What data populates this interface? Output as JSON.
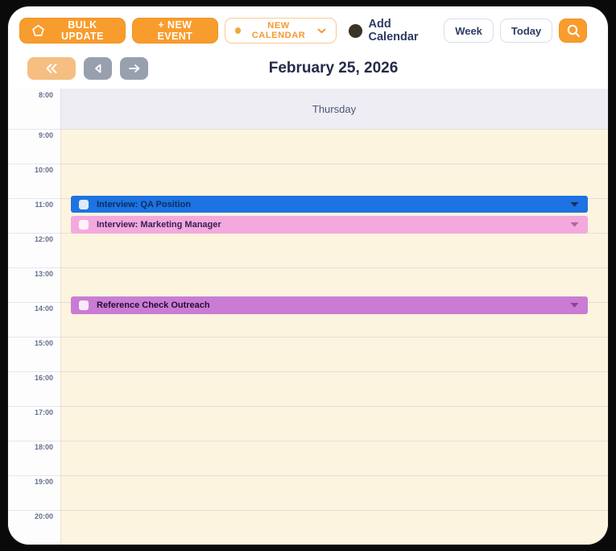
{
  "header": {
    "date_title": "February 25, 2026"
  },
  "toolbar": {
    "bulk_update_label": "BULK UPDATE",
    "new_event_label": "+ NEW EVENT",
    "calendar_select": {
      "label": "NEW CALENDAR"
    },
    "add_calendar_label": "Add Calendar",
    "week_label": "Week",
    "today_label": "Today"
  },
  "calendar": {
    "day_header": "Thursday",
    "time_labels": [
      "8:00",
      "9:00",
      "10:00",
      "11:00",
      "12:00",
      "13:00",
      "14:00",
      "15:00",
      "16:00",
      "17:00",
      "18:00",
      "19:00",
      "20:00"
    ],
    "events": [
      {
        "title": "Interview: QA Position",
        "color": "#1D73E2",
        "text_color": "#0C2D5E",
        "chevron_color": "#16305C"
      },
      {
        "title": "Interview: Marketing Manager",
        "color": "#F3A9DD",
        "text_color": "#372052",
        "chevron_color": "#B761A8"
      },
      {
        "title": "Reference Check Outreach",
        "color": "#CA7CD5",
        "text_color": "#230F33",
        "chevron_color": "#8E3F9B"
      }
    ]
  },
  "icons": {
    "bulk_update": "pentagon-outline",
    "calendar_select": "dot-and-chevron-down",
    "add_calendar": "two-tone-circle",
    "search": "magnifier",
    "nav_first": "double-chevron-left",
    "nav_prev": "triangle-left",
    "nav_next": "arrow-right",
    "event_left": "checkbox",
    "event_right": "chevron-down"
  },
  "colors": {
    "accent_orange": "#F89C2D",
    "nav_orange_light": "#F6BE81",
    "nav_gray": "#98A0B0",
    "navy_text": "#2E3A59",
    "cream_column": "#FCF4DF",
    "day_header_band": "#EDEDF3",
    "card_background": "#FFFFFF",
    "page_background": "#0A0A0A"
  }
}
